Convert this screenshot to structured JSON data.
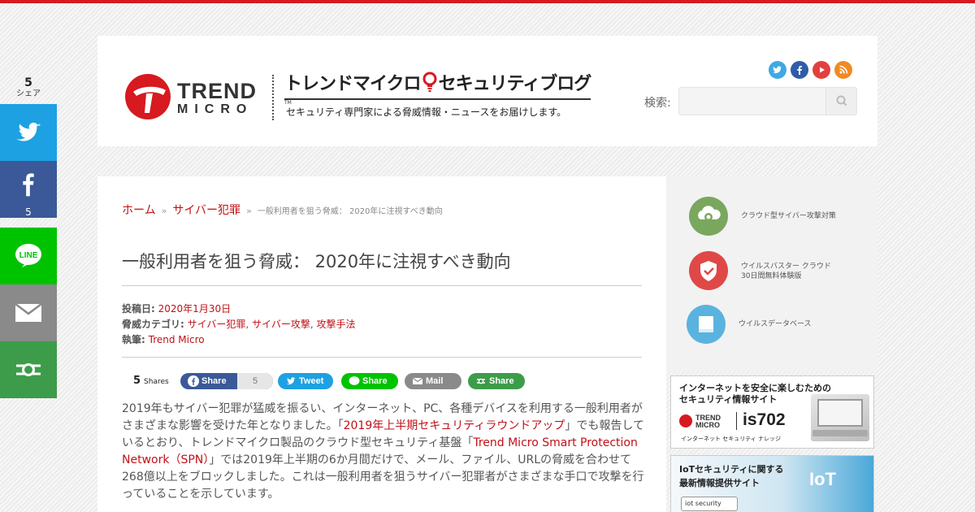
{
  "header": {
    "logo_word1": "TREND",
    "logo_word2": "MICRO",
    "logo_tm": "TM",
    "blog_title_part1": "トレンドマイクロ",
    "blog_title_part2": "セキュリティブログ",
    "blog_subtitle": "セキュリティ専門家による脅威情報・ニュースをお届けします。",
    "search_label": "検索:",
    "search_placeholder": "",
    "social_icons": [
      {
        "name": "twitter-icon",
        "color": "#3fa9e2"
      },
      {
        "name": "facebook-icon",
        "color": "#2f5da8"
      },
      {
        "name": "youtube-icon",
        "color": "#e23f3f"
      },
      {
        "name": "rss-icon",
        "color": "#f08a24"
      }
    ]
  },
  "breadcrumb": {
    "home": "ホーム",
    "separator": "»",
    "category": "サイバー犯罪",
    "current": "一般利用者を狙う脅威： 2020年に注視すべき動向"
  },
  "article": {
    "title": "一般利用者を狙う脅威： 2020年に注視すべき動向",
    "meta": {
      "posted_label": "投稿日:",
      "posted_value": "2020年1月30日",
      "category_label": "脅威カテゴリ:",
      "categories": [
        "サイバー犯罪",
        "サイバー攻撃",
        "攻撃手法"
      ],
      "category_sep": ",",
      "author_label": "執筆:",
      "author_value": "Trend Micro"
    },
    "share": {
      "count": "5",
      "count_label": "Shares",
      "facebook_label": "Share",
      "facebook_count": "5",
      "twitter_label": "Tweet",
      "line_label": "Share",
      "mail_label": "Mail",
      "more_label": "Share"
    },
    "body": {
      "p1_a": "2019年もサイバー犯罪が猛威を振るい、インターネット、PC、各種デバイスを利用する一般利用者がさまざまな影響を受けた年となりました。「",
      "p1_link1": "2019年上半期セキュリティラウンドアップ",
      "p1_b": "」でも報告しているとおり、トレンドマイクロ製品のクラウド型セキュリティ基盤「",
      "p1_link2": "Trend Micro Smart Protection Network（SPN）",
      "p1_c": "」では2019年上半期の6か月間だけで、メール、ファイル、URLの脅威を合わせて268億以上をブロックしました。これは一般利用者を狙うサイバー犯罪者がさまざまな手口で攻撃を行っていることを示しています。"
    }
  },
  "sidebar": {
    "items": [
      {
        "label": "クラウド型サイバー攻撃対策",
        "icon": "cloud-shield-icon",
        "color": "#7aa75e"
      },
      {
        "label_line1": "ウイルスバスター クラウド",
        "label_line2": "30日間無料体験版",
        "icon": "shield-check-icon",
        "color": "#e04848"
      },
      {
        "label": "ウイルスデータベース",
        "icon": "book-icon",
        "color": "#5ab3de"
      }
    ],
    "banner1": {
      "line1": "インターネットを安全に楽しむための",
      "line2": "セキュリティ情報サイト",
      "brand": "TREND MICRO",
      "product": "is702",
      "tagline": "インターネット セキュリティ ナレッジ"
    },
    "banner2": {
      "line1": "IoTセキュリティに関する",
      "line2": "最新情報提供サイト",
      "badge": "iot security",
      "overlay": "IoT"
    }
  },
  "floating_share": {
    "count": "5",
    "count_label": "シェア",
    "facebook_count": "5",
    "buttons": [
      {
        "name": "twitter",
        "color": "#1da1e2"
      },
      {
        "name": "facebook",
        "color": "#3b5998"
      },
      {
        "name": "line",
        "color": "#00c300"
      },
      {
        "name": "mail",
        "color": "#8a8a8a"
      },
      {
        "name": "more",
        "color": "#3d9c4a"
      }
    ]
  }
}
